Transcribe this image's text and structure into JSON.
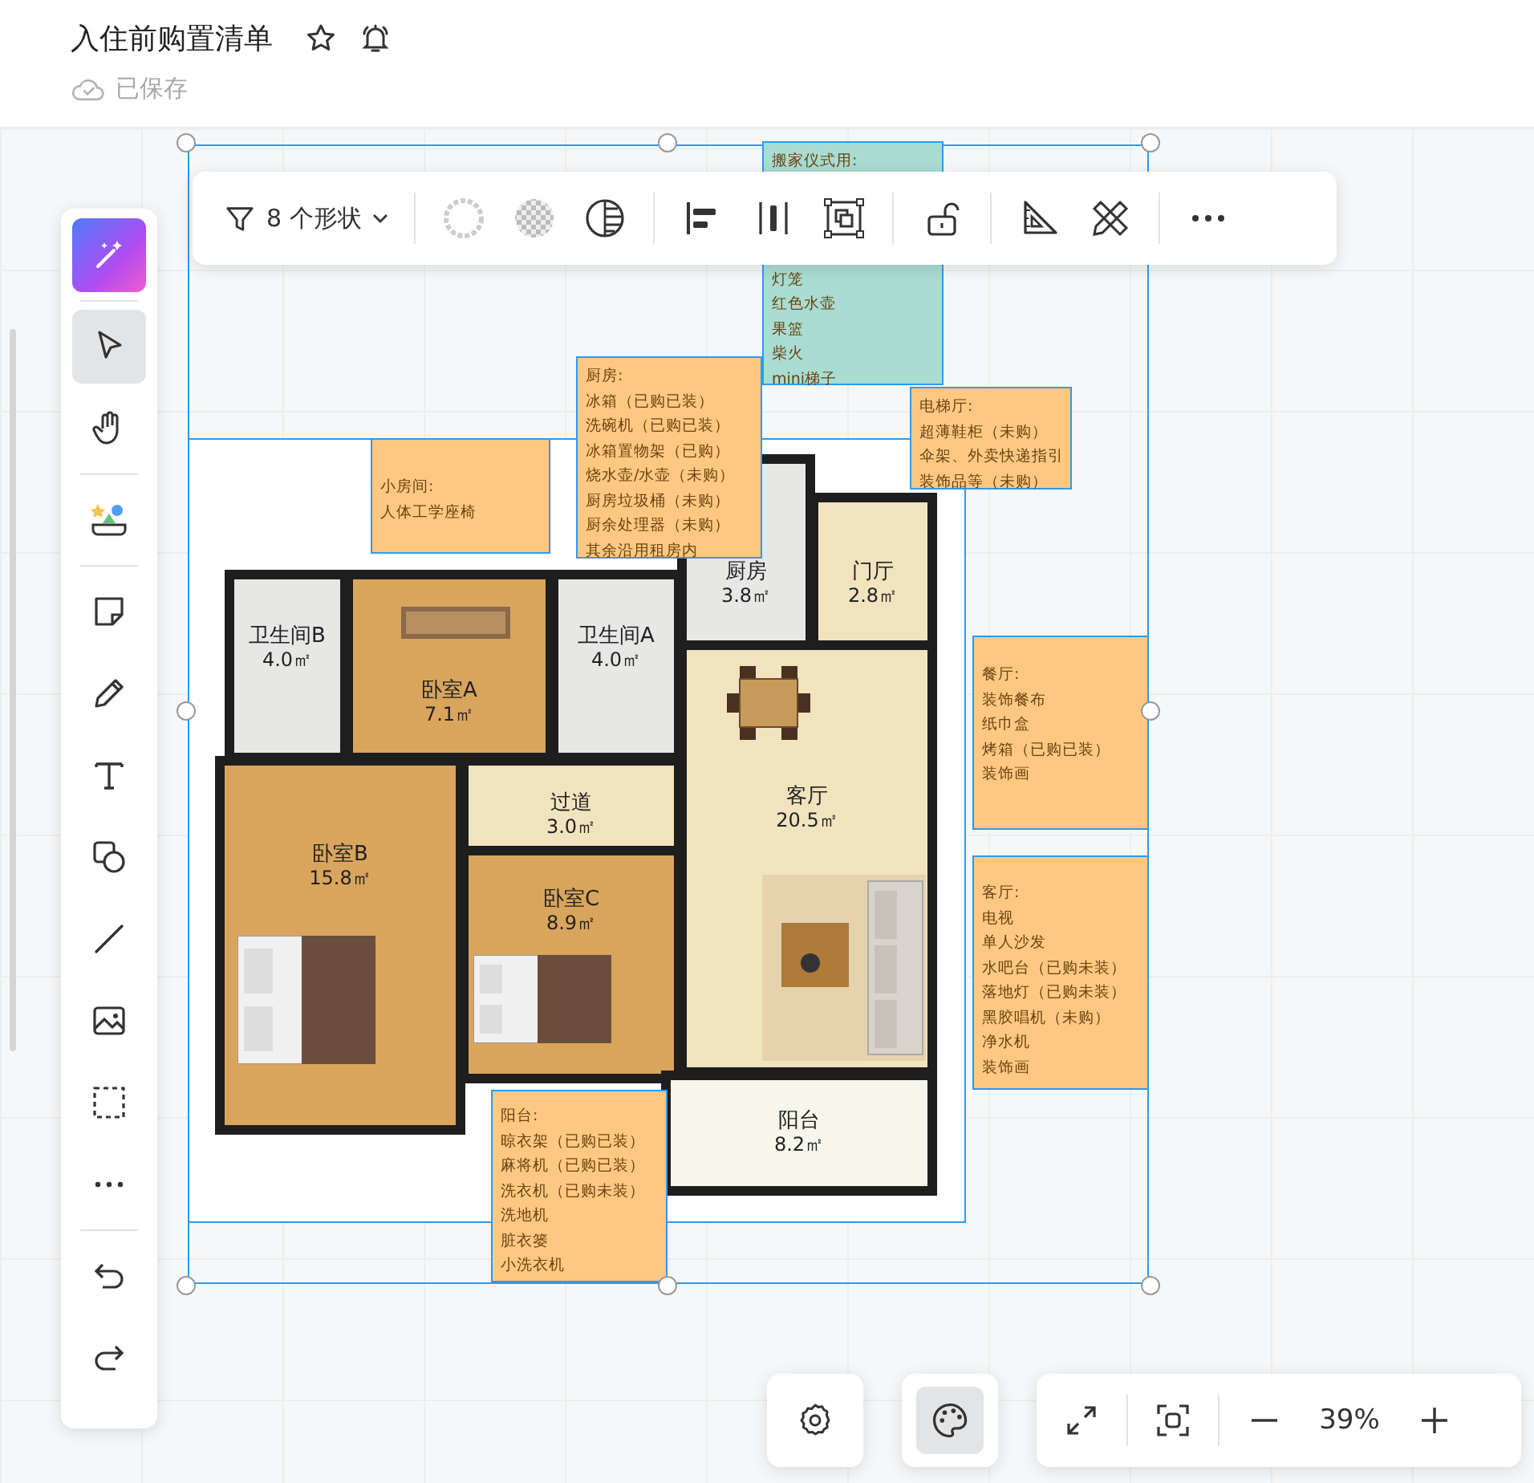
{
  "document": {
    "title": "入住前购置清单",
    "save_status": "已保存"
  },
  "tool_sidebar": {
    "tools": [
      {
        "kind": "ai",
        "selected": false
      },
      {
        "kind": "select",
        "selected": true
      },
      {
        "kind": "hand",
        "selected": false
      },
      {
        "kind": "library",
        "selected": false
      },
      {
        "kind": "sticky",
        "selected": false
      },
      {
        "kind": "pen",
        "selected": false
      },
      {
        "kind": "text",
        "selected": false
      },
      {
        "kind": "shape",
        "selected": false
      },
      {
        "kind": "line",
        "selected": false
      },
      {
        "kind": "image",
        "selected": false
      },
      {
        "kind": "frame",
        "selected": false
      },
      {
        "kind": "more",
        "selected": false
      },
      {
        "kind": "undo",
        "selected": false
      },
      {
        "kind": "redo",
        "selected": false
      }
    ]
  },
  "selection_toolbar": {
    "shape_filter": "8 个形状"
  },
  "canvas": {
    "notes": [
      {
        "color": "#a9dcd2",
        "lines": [
          "搬家仪式用:",
          "灯笼",
          "红色水壶",
          "果篮",
          "柴火",
          "mini梯子"
        ]
      },
      {
        "color": "#fec882",
        "lines": [
          "厨房:",
          "冰箱（已购已装）",
          "洗碗机（已购已装）",
          "冰箱置物架（已购）",
          "烧水壶/水壶（未购）",
          "厨房垃圾桶（未购）",
          "厨余处理器（未购）",
          "其余沿用租房内"
        ]
      },
      {
        "color": "#fec882",
        "lines": [
          "电梯厅:",
          "超薄鞋柜（未购）",
          "伞架、外卖快递指引",
          "装饰品等（未购）"
        ]
      },
      {
        "color": "#fec882",
        "lines": [
          "小房间:",
          "人体工学座椅"
        ]
      },
      {
        "color": "#fec882",
        "lines": [
          "餐厅:",
          "装饰餐布",
          "纸巾盒",
          "烤箱（已购已装）",
          "装饰画"
        ]
      },
      {
        "color": "#fec882",
        "lines": [
          "客厅:",
          "电视",
          "单人沙发",
          "水吧台（已购未装）",
          "落地灯（已购未装）",
          "黑胶唱机（未购）",
          "净水机",
          "装饰画"
        ]
      },
      {
        "color": "#fec882",
        "lines": [
          "阳台:",
          "晾衣架（已购已装）",
          "麻将机（已购已装）",
          "洗衣机（已购未装）",
          "洗地机",
          "脏衣篓",
          "小洗衣机"
        ]
      }
    ],
    "floor_plan": {
      "rooms": [
        {
          "kind": "tile",
          "name": "卫生间B",
          "area": "4.0㎡"
        },
        {
          "kind": "wood",
          "name": "卧室A",
          "area": "7.1㎡"
        },
        {
          "kind": "tile",
          "name": "卫生间A",
          "area": "4.0㎡"
        },
        {
          "kind": "tile",
          "name": "厨房",
          "area": "3.8㎡"
        },
        {
          "kind": "marble",
          "name": "门厅",
          "area": "2.8㎡"
        },
        {
          "kind": "marble",
          "name": "过道",
          "area": "3.0㎡"
        },
        {
          "kind": "marble",
          "name": "客厅",
          "area": "20.5㎡"
        },
        {
          "kind": "wood",
          "name": "卧室B",
          "area": "15.8㎡"
        },
        {
          "kind": "wood",
          "name": "卧室C",
          "area": "8.9㎡"
        },
        {
          "kind": "plain",
          "name": "阳台",
          "area": "8.2㎡"
        }
      ]
    }
  },
  "bottom_buttons": [
    {
      "kind": "settings",
      "selected": false
    },
    {
      "kind": "theme",
      "selected": true
    }
  ],
  "zoom": {
    "label": "39%"
  }
}
